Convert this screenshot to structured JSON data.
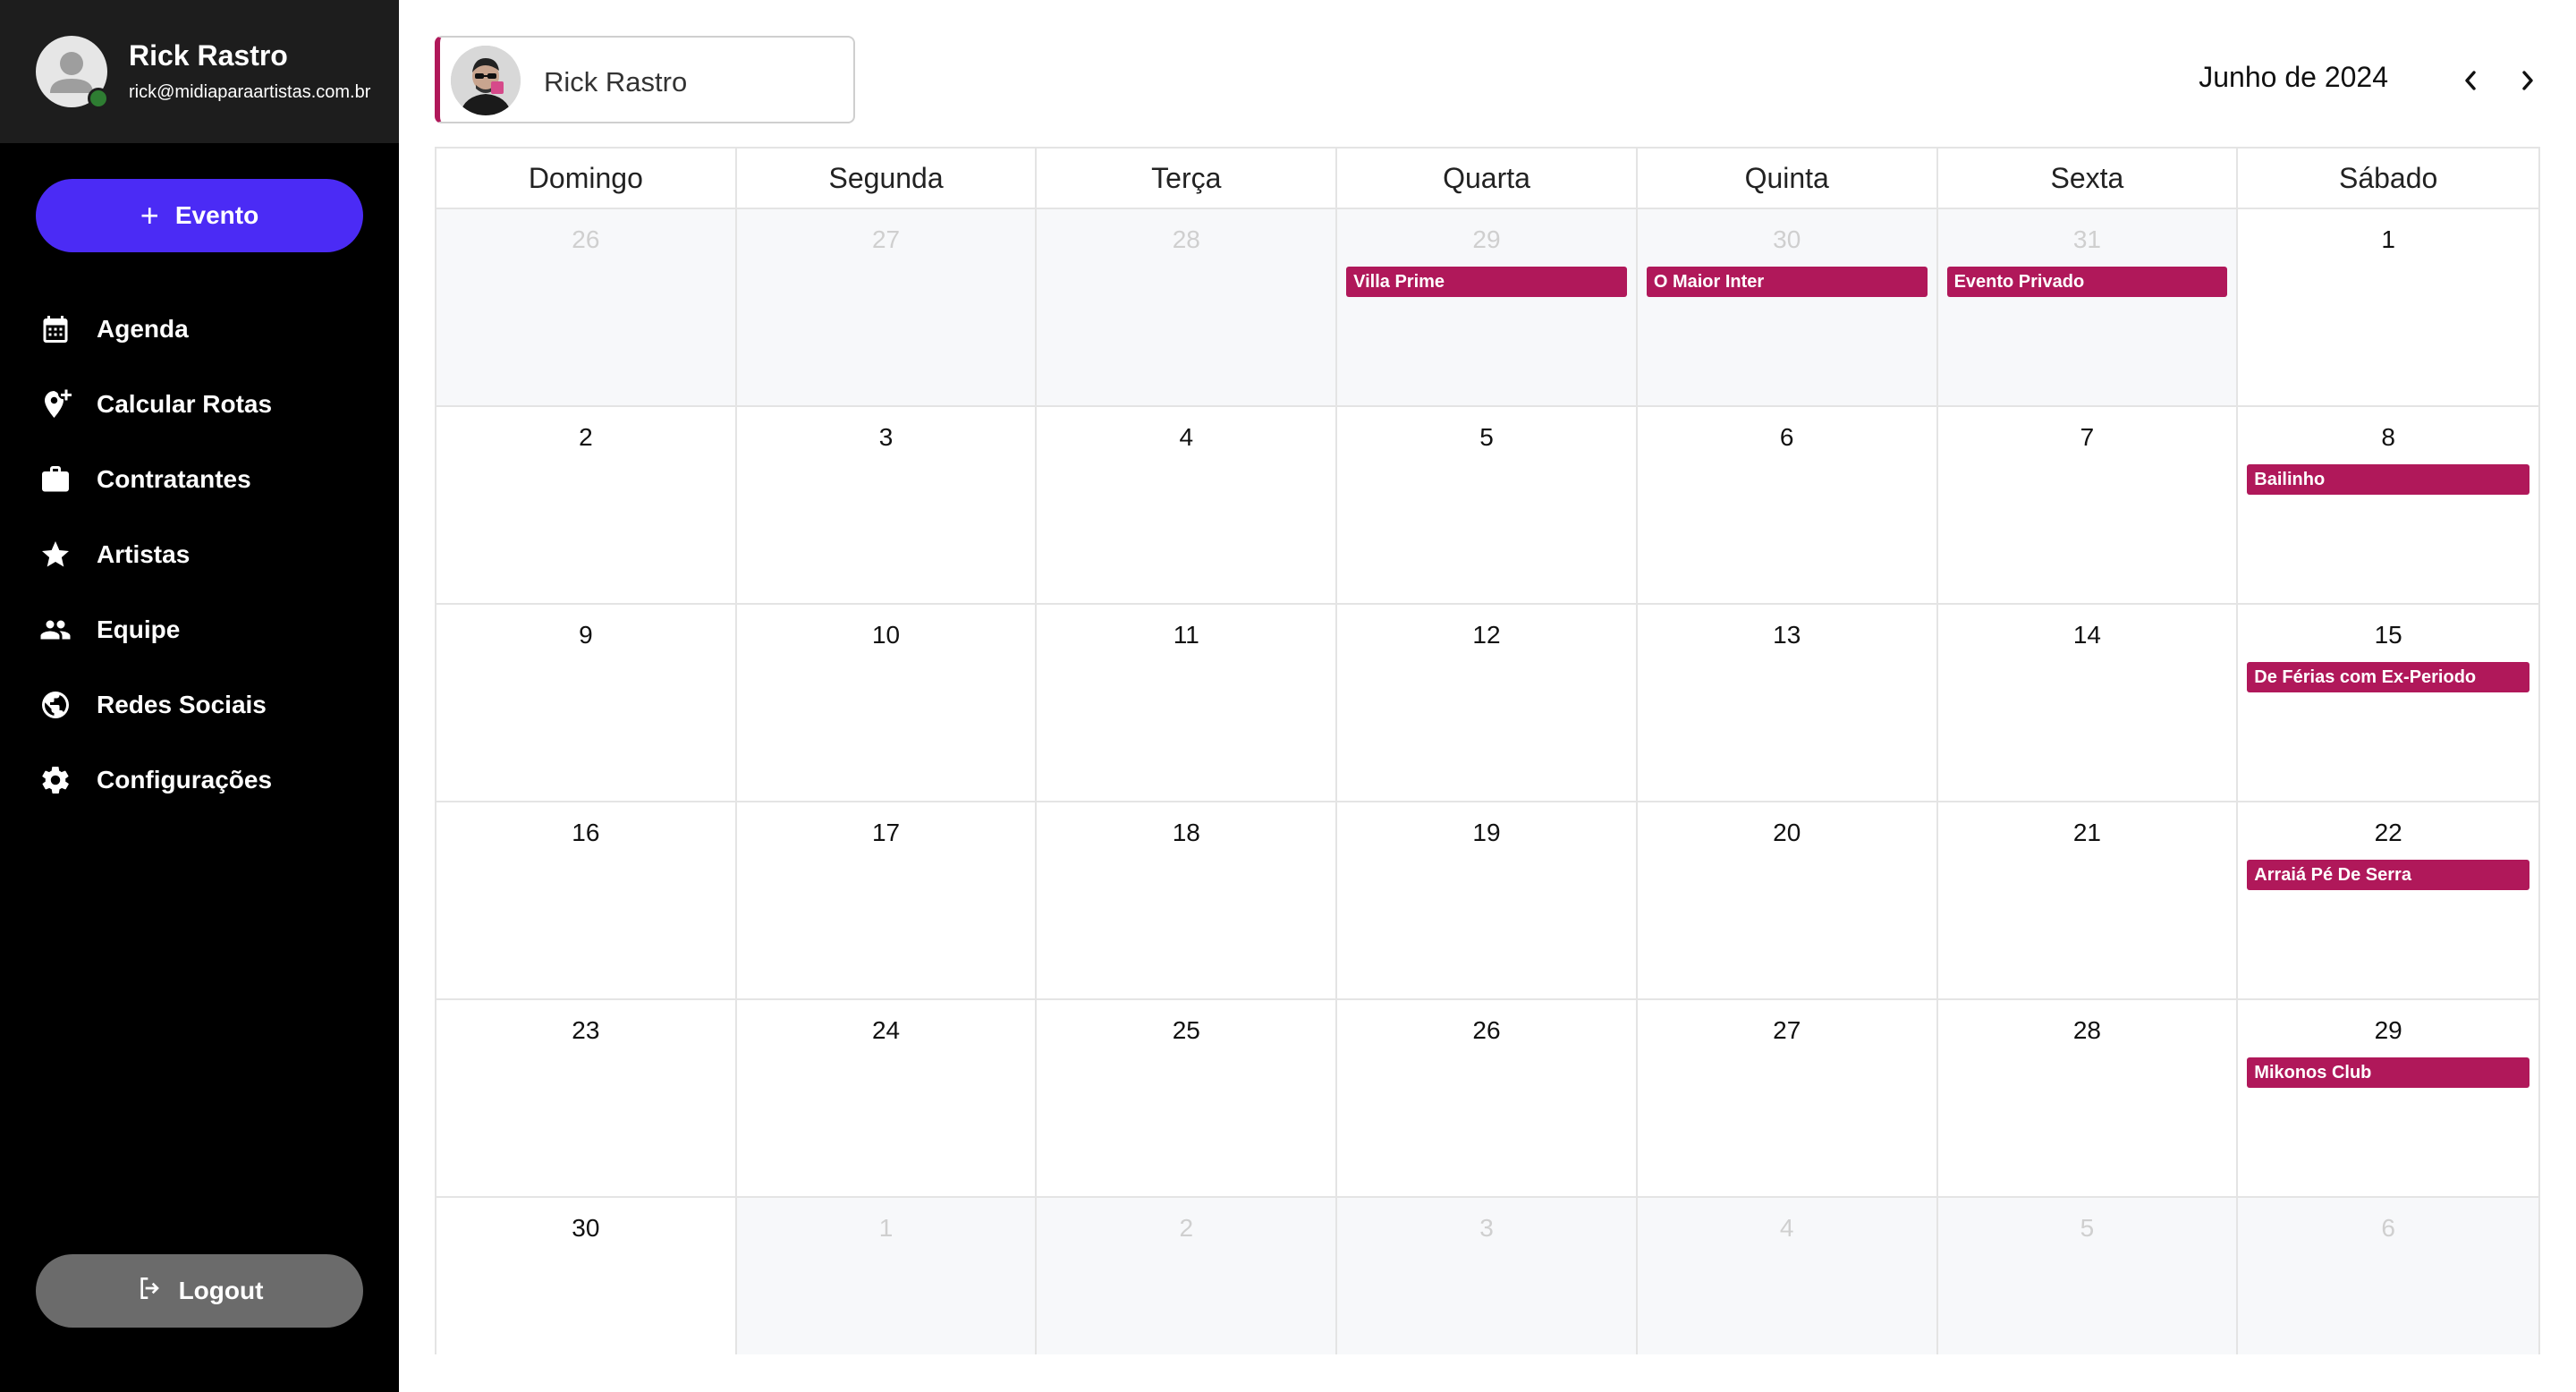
{
  "user": {
    "name": "Rick Rastro",
    "email": "rick@midiaparaartistas.com.br"
  },
  "actions": {
    "new_event": "Evento",
    "logout": "Logout"
  },
  "nav": [
    {
      "label": "Agenda",
      "icon": "calendar-icon"
    },
    {
      "label": "Calcular Rotas",
      "icon": "add-location-icon"
    },
    {
      "label": "Contratantes",
      "icon": "briefcase-icon"
    },
    {
      "label": "Artistas",
      "icon": "star-icon"
    },
    {
      "label": "Equipe",
      "icon": "people-icon"
    },
    {
      "label": "Redes Sociais",
      "icon": "globe-icon"
    },
    {
      "label": "Configurações",
      "icon": "gear-icon"
    }
  ],
  "artist_selector": {
    "name": "Rick Rastro"
  },
  "calendar": {
    "title": "Junho de 2024",
    "weekdays": [
      "Domingo",
      "Segunda",
      "Terça",
      "Quarta",
      "Quinta",
      "Sexta",
      "Sábado"
    ],
    "weeks": [
      [
        {
          "day": "26",
          "out": true
        },
        {
          "day": "27",
          "out": true
        },
        {
          "day": "28",
          "out": true
        },
        {
          "day": "29",
          "out": true,
          "event": "Villa Prime"
        },
        {
          "day": "30",
          "out": true,
          "event": "O Maior Inter"
        },
        {
          "day": "31",
          "out": true,
          "event": "Evento Privado"
        },
        {
          "day": "1"
        }
      ],
      [
        {
          "day": "2"
        },
        {
          "day": "3"
        },
        {
          "day": "4"
        },
        {
          "day": "5"
        },
        {
          "day": "6"
        },
        {
          "day": "7"
        },
        {
          "day": "8",
          "event": "Bailinho"
        }
      ],
      [
        {
          "day": "9"
        },
        {
          "day": "10"
        },
        {
          "day": "11"
        },
        {
          "day": "12"
        },
        {
          "day": "13"
        },
        {
          "day": "14"
        },
        {
          "day": "15",
          "event": "De Férias com Ex-Periodo"
        }
      ],
      [
        {
          "day": "16"
        },
        {
          "day": "17"
        },
        {
          "day": "18"
        },
        {
          "day": "19"
        },
        {
          "day": "20"
        },
        {
          "day": "21"
        },
        {
          "day": "22",
          "event": "Arraiá Pé De Serra"
        }
      ],
      [
        {
          "day": "23"
        },
        {
          "day": "24"
        },
        {
          "day": "25"
        },
        {
          "day": "26"
        },
        {
          "day": "27"
        },
        {
          "day": "28"
        },
        {
          "day": "29",
          "event": "Mikonos Club"
        }
      ],
      [
        {
          "day": "30"
        },
        {
          "day": "1",
          "out": true
        },
        {
          "day": "2",
          "out": true
        },
        {
          "day": "3",
          "out": true
        },
        {
          "day": "4",
          "out": true
        },
        {
          "day": "5",
          "out": true
        },
        {
          "day": "6",
          "out": true
        }
      ]
    ]
  },
  "colors": {
    "sidebar": "#000000",
    "profile_bar": "#1d1d1d",
    "primary_button": "#4b2bf5",
    "logout_button": "#6b6b6b",
    "event": "#b0185a",
    "outside_month_bg": "#f7f8fa",
    "online_status": "#2e7d32"
  }
}
